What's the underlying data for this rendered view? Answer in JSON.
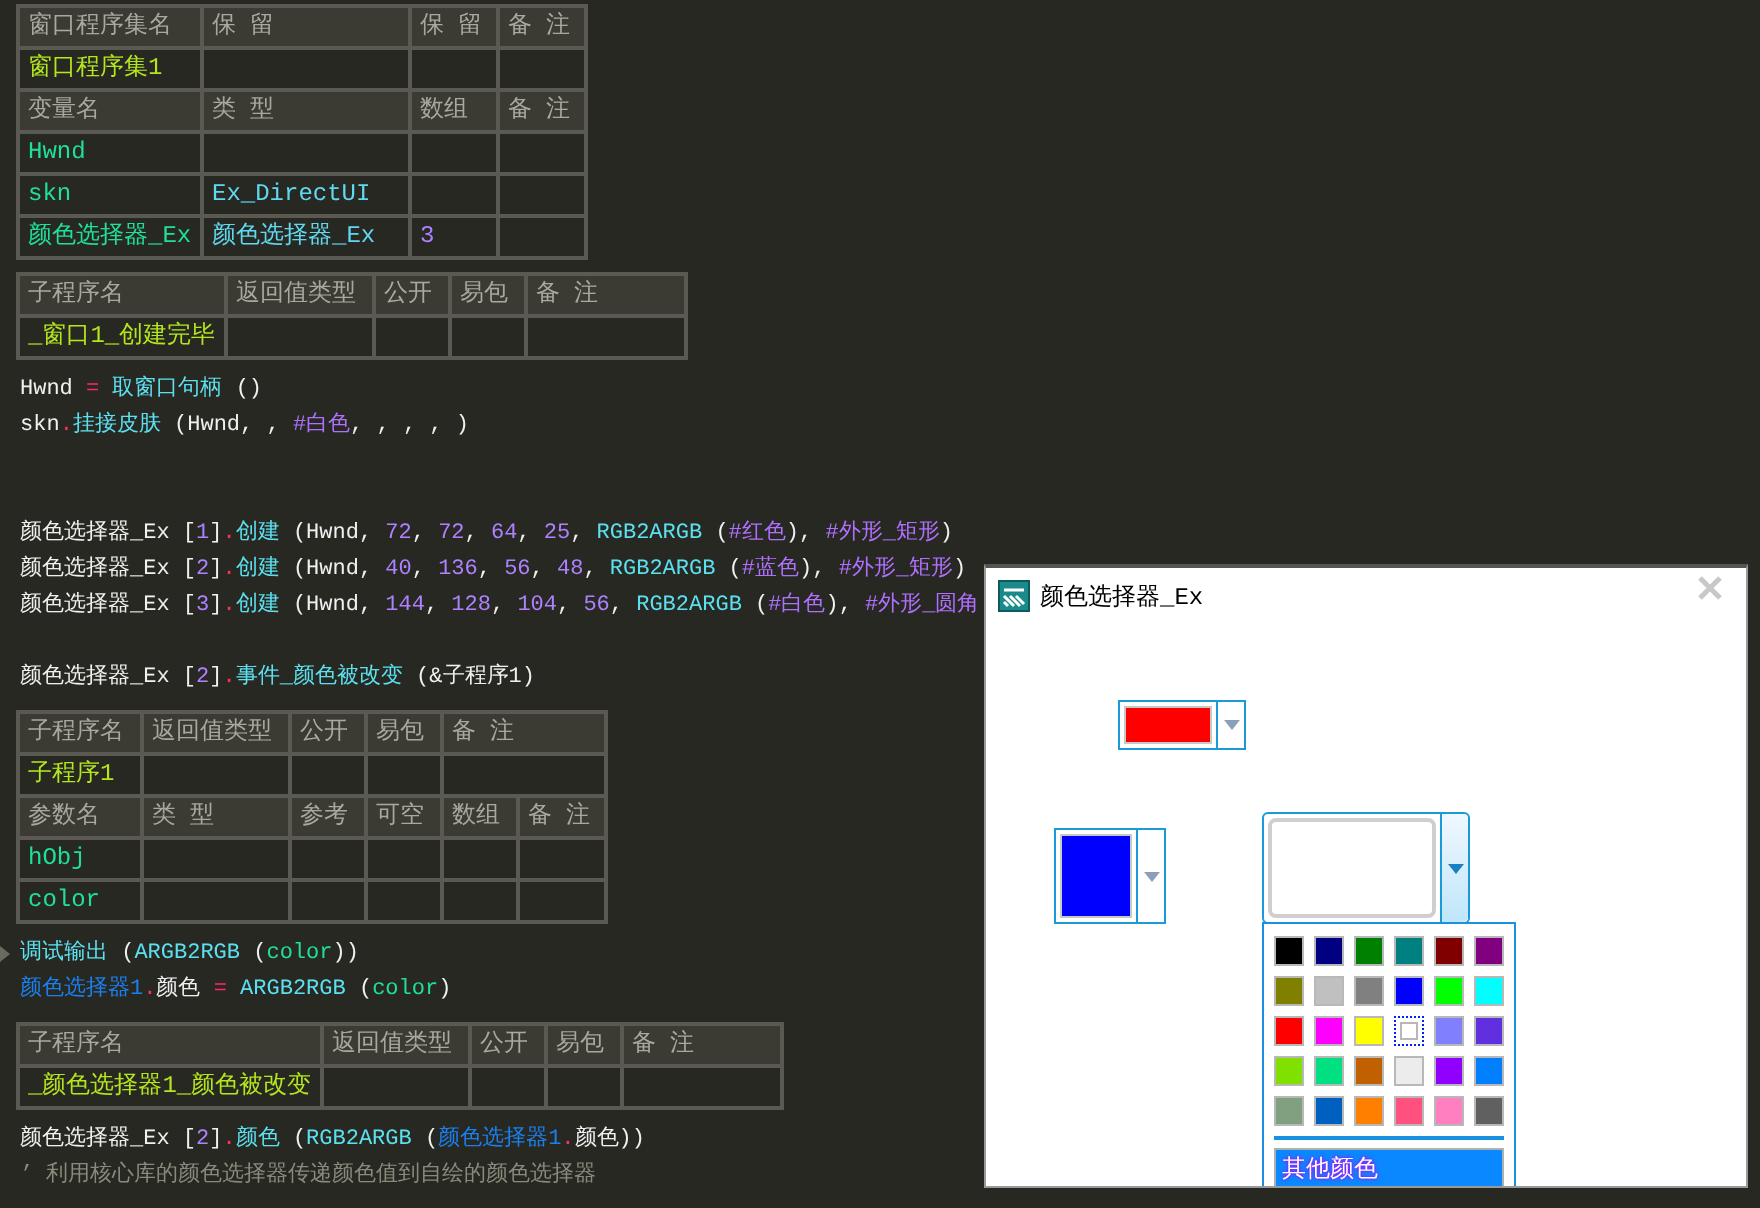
{
  "code": {
    "blocks": [
      {
        "kind": "table",
        "rows": [
          {
            "kind": "header",
            "cells": [
              {
                "text": "窗口程序集名",
                "kind": "head"
              },
              {
                "text": "保 留",
                "kind": "head"
              },
              {
                "text": "保 留",
                "kind": "head"
              },
              {
                "text": "备 注",
                "kind": "head"
              }
            ]
          },
          {
            "kind": "data",
            "cells": [
              {
                "text": "窗口程序集1",
                "kind": "name"
              }
            ]
          },
          {
            "kind": "header",
            "cells": [
              {
                "text": "变量名",
                "kind": "head"
              },
              {
                "text": "类 型",
                "kind": "head"
              },
              {
                "text": "数组",
                "kind": "head"
              },
              {
                "text": "备 注",
                "kind": "head"
              }
            ]
          },
          {
            "kind": "data",
            "cells": [
              {
                "text": "Hwnd",
                "kind": "var"
              }
            ]
          },
          {
            "kind": "data",
            "cells": [
              {
                "text": "skn",
                "kind": "var"
              },
              {
                "text": "Ex_DirectUI",
                "kind": "type"
              }
            ]
          },
          {
            "kind": "data",
            "cells": [
              {
                "text": "颜色选择器_Ex",
                "kind": "var"
              },
              {
                "text": "颜色选择器_Ex",
                "kind": "type"
              },
              {
                "text": "3",
                "kind": "num"
              }
            ]
          }
        ]
      },
      {
        "kind": "table",
        "rows": [
          {
            "kind": "header",
            "cells": [
              {
                "text": "子程序名",
                "kind": "head"
              },
              {
                "text": "返回值类型",
                "kind": "head"
              },
              {
                "text": "公开",
                "kind": "head"
              },
              {
                "text": "易包",
                "kind": "head"
              },
              {
                "text": "备 注",
                "kind": "head"
              }
            ]
          },
          {
            "kind": "data",
            "cells": [
              {
                "text": "_窗口1_创建完毕",
                "kind": "name"
              }
            ]
          }
        ]
      },
      {
        "kind": "line",
        "tokens": [
          {
            "text": "Hwnd ",
            "kind": "plain"
          },
          {
            "text": "=",
            "kind": "op"
          },
          {
            "text": " 取窗口句柄",
            "kind": "func"
          },
          {
            "text": " ()",
            "kind": "plain"
          }
        ]
      },
      {
        "kind": "line",
        "tokens": [
          {
            "text": "skn",
            "kind": "plain"
          },
          {
            "text": ".",
            "kind": "dot"
          },
          {
            "text": "挂接皮肤",
            "kind": "func"
          },
          {
            "text": " (Hwnd, , ",
            "kind": "plain"
          },
          {
            "text": "#白色",
            "kind": "const"
          },
          {
            "text": ", , , , )",
            "kind": "plain"
          }
        ]
      },
      {
        "kind": "blank"
      },
      {
        "kind": "blank"
      },
      {
        "kind": "line",
        "tokens": [
          {
            "text": "颜色选择器_Ex [",
            "kind": "plain"
          },
          {
            "text": "1",
            "kind": "num"
          },
          {
            "text": "]",
            "kind": "plain"
          },
          {
            "text": ".",
            "kind": "dot"
          },
          {
            "text": "创建",
            "kind": "func"
          },
          {
            "text": " (Hwnd, ",
            "kind": "plain"
          },
          {
            "text": "72",
            "kind": "num"
          },
          {
            "text": ", ",
            "kind": "plain"
          },
          {
            "text": "72",
            "kind": "num"
          },
          {
            "text": ", ",
            "kind": "plain"
          },
          {
            "text": "64",
            "kind": "num"
          },
          {
            "text": ", ",
            "kind": "plain"
          },
          {
            "text": "25",
            "kind": "num"
          },
          {
            "text": ", ",
            "kind": "plain"
          },
          {
            "text": "RGB2ARGB",
            "kind": "func"
          },
          {
            "text": " (",
            "kind": "plain"
          },
          {
            "text": "#红色",
            "kind": "const"
          },
          {
            "text": "), ",
            "kind": "plain"
          },
          {
            "text": "#外形_矩形",
            "kind": "const"
          },
          {
            "text": ")",
            "kind": "plain"
          }
        ]
      },
      {
        "kind": "line",
        "tokens": [
          {
            "text": "颜色选择器_Ex [",
            "kind": "plain"
          },
          {
            "text": "2",
            "kind": "num"
          },
          {
            "text": "]",
            "kind": "plain"
          },
          {
            "text": ".",
            "kind": "dot"
          },
          {
            "text": "创建",
            "kind": "func"
          },
          {
            "text": " (Hwnd, ",
            "kind": "plain"
          },
          {
            "text": "40",
            "kind": "num"
          },
          {
            "text": ", ",
            "kind": "plain"
          },
          {
            "text": "136",
            "kind": "num"
          },
          {
            "text": ", ",
            "kind": "plain"
          },
          {
            "text": "56",
            "kind": "num"
          },
          {
            "text": ", ",
            "kind": "plain"
          },
          {
            "text": "48",
            "kind": "num"
          },
          {
            "text": ", ",
            "kind": "plain"
          },
          {
            "text": "RGB2ARGB",
            "kind": "func"
          },
          {
            "text": " (",
            "kind": "plain"
          },
          {
            "text": "#蓝色",
            "kind": "const"
          },
          {
            "text": "), ",
            "kind": "plain"
          },
          {
            "text": "#外形_矩形",
            "kind": "const"
          },
          {
            "text": ")",
            "kind": "plain"
          }
        ]
      },
      {
        "kind": "line",
        "tokens": [
          {
            "text": "颜色选择器_Ex [",
            "kind": "plain"
          },
          {
            "text": "3",
            "kind": "num"
          },
          {
            "text": "]",
            "kind": "plain"
          },
          {
            "text": ".",
            "kind": "dot"
          },
          {
            "text": "创建",
            "kind": "func"
          },
          {
            "text": " (Hwnd, ",
            "kind": "plain"
          },
          {
            "text": "144",
            "kind": "num"
          },
          {
            "text": ", ",
            "kind": "plain"
          },
          {
            "text": "128",
            "kind": "num"
          },
          {
            "text": ", ",
            "kind": "plain"
          },
          {
            "text": "104",
            "kind": "num"
          },
          {
            "text": ", ",
            "kind": "plain"
          },
          {
            "text": "56",
            "kind": "num"
          },
          {
            "text": ", ",
            "kind": "plain"
          },
          {
            "text": "RGB2ARGB",
            "kind": "func"
          },
          {
            "text": " (",
            "kind": "plain"
          },
          {
            "text": "#白色",
            "kind": "const"
          },
          {
            "text": "), ",
            "kind": "plain"
          },
          {
            "text": "#外形_圆角",
            "kind": "const"
          }
        ]
      },
      {
        "kind": "blank"
      },
      {
        "kind": "line",
        "tokens": [
          {
            "text": "颜色选择器_Ex [",
            "kind": "plain"
          },
          {
            "text": "2",
            "kind": "num"
          },
          {
            "text": "]",
            "kind": "plain"
          },
          {
            "text": ".",
            "kind": "dot"
          },
          {
            "text": "事件_颜色被改变",
            "kind": "func"
          },
          {
            "text": " (&子程序1)",
            "kind": "plain"
          }
        ]
      },
      {
        "kind": "table",
        "rows": [
          {
            "kind": "header",
            "cells": [
              {
                "text": "子程序名",
                "kind": "head"
              },
              {
                "text": "返回值类型",
                "kind": "head"
              },
              {
                "text": "公开",
                "kind": "head"
              },
              {
                "text": "易包",
                "kind": "head"
              },
              {
                "text": "备 注",
                "kind": "head"
              }
            ]
          },
          {
            "kind": "data",
            "cells": [
              {
                "text": "子程序1",
                "kind": "name"
              }
            ]
          },
          {
            "kind": "header",
            "cells": [
              {
                "text": "参数名",
                "kind": "head"
              },
              {
                "text": "类 型",
                "kind": "head"
              },
              {
                "text": "参考",
                "kind": "head"
              },
              {
                "text": "可空",
                "kind": "head"
              },
              {
                "text": "数组",
                "kind": "head"
              },
              {
                "text": "备 注",
                "kind": "head"
              }
            ]
          },
          {
            "kind": "data",
            "cells": [
              {
                "text": "hObj",
                "kind": "var"
              }
            ]
          },
          {
            "kind": "data",
            "cells": [
              {
                "text": "color",
                "kind": "var"
              }
            ]
          }
        ]
      },
      {
        "kind": "line",
        "marker": true,
        "tokens": [
          {
            "text": "调试输出",
            "kind": "func"
          },
          {
            "text": " (",
            "kind": "plain"
          },
          {
            "text": "ARGB2RGB",
            "kind": "func"
          },
          {
            "text": " (",
            "kind": "plain"
          },
          {
            "text": "color",
            "kind": "var"
          },
          {
            "text": "))",
            "kind": "plain"
          }
        ]
      },
      {
        "kind": "line",
        "tokens": [
          {
            "text": "颜色选择器1",
            "kind": "obj"
          },
          {
            "text": ".",
            "kind": "dot"
          },
          {
            "text": "颜色 ",
            "kind": "plain"
          },
          {
            "text": "=",
            "kind": "op"
          },
          {
            "text": " ARGB2RGB",
            "kind": "func"
          },
          {
            "text": " (",
            "kind": "plain"
          },
          {
            "text": "color",
            "kind": "var"
          },
          {
            "text": ")",
            "kind": "plain"
          }
        ]
      },
      {
        "kind": "table",
        "rows": [
          {
            "kind": "header",
            "cells": [
              {
                "text": "子程序名",
                "kind": "head"
              },
              {
                "text": "返回值类型",
                "kind": "head"
              },
              {
                "text": "公开",
                "kind": "head"
              },
              {
                "text": "易包",
                "kind": "head"
              },
              {
                "text": "备 注",
                "kind": "head"
              }
            ]
          },
          {
            "kind": "data",
            "cells": [
              {
                "text": "_颜色选择器1_颜色被改变",
                "kind": "name"
              }
            ]
          }
        ]
      },
      {
        "kind": "line",
        "tokens": [
          {
            "text": "颜色选择器_Ex [",
            "kind": "plain"
          },
          {
            "text": "2",
            "kind": "num"
          },
          {
            "text": "]",
            "kind": "plain"
          },
          {
            "text": ".",
            "kind": "dot"
          },
          {
            "text": "颜色",
            "kind": "func"
          },
          {
            "text": " (",
            "kind": "plain"
          },
          {
            "text": "RGB2ARGB",
            "kind": "func"
          },
          {
            "text": " (",
            "kind": "plain"
          },
          {
            "text": "颜色选择器1",
            "kind": "obj"
          },
          {
            "text": ".",
            "kind": "dot"
          },
          {
            "text": "颜色",
            "kind": "plain"
          },
          {
            "text": "))",
            "kind": "plain"
          }
        ]
      },
      {
        "kind": "line",
        "tokens": [
          {
            "text": "’ 利用核心库的颜色选择器传递颜色值到自绘的颜色选择器",
            "kind": "comment"
          }
        ]
      }
    ]
  },
  "dialog": {
    "title": "颜色选择器_Ex",
    "pickers": [
      {
        "color": "#ff0000",
        "expanded": false
      },
      {
        "color": "#0000ff",
        "expanded": false
      },
      {
        "color": "#ffffff",
        "expanded": true
      }
    ],
    "palette": {
      "colors": [
        {
          "color": "#000000",
          "selected": false
        },
        {
          "color": "#000080",
          "selected": false
        },
        {
          "color": "#008000",
          "selected": false
        },
        {
          "color": "#008080",
          "selected": false
        },
        {
          "color": "#800000",
          "selected": false
        },
        {
          "color": "#800080",
          "selected": false
        },
        {
          "color": "#808000",
          "selected": false
        },
        {
          "color": "#c0c0c0",
          "selected": false
        },
        {
          "color": "#808080",
          "selected": false
        },
        {
          "color": "#0000ff",
          "selected": false
        },
        {
          "color": "#00ff00",
          "selected": false
        },
        {
          "color": "#00ffff",
          "selected": false
        },
        {
          "color": "#ff0000",
          "selected": false
        },
        {
          "color": "#ff00ff",
          "selected": false
        },
        {
          "color": "#ffff00",
          "selected": false
        },
        {
          "color": "#ffffff",
          "selected": true
        },
        {
          "color": "#8080ff",
          "selected": false
        },
        {
          "color": "#6030e0",
          "selected": false
        },
        {
          "color": "#80e000",
          "selected": false
        },
        {
          "color": "#00e080",
          "selected": false
        },
        {
          "color": "#c06000",
          "selected": false
        },
        {
          "color": "#ececec",
          "selected": false
        },
        {
          "color": "#9000ff",
          "selected": false
        },
        {
          "color": "#0080ff",
          "selected": false
        },
        {
          "color": "#80a080",
          "selected": false
        },
        {
          "color": "#0060c0",
          "selected": false
        },
        {
          "color": "#ff8000",
          "selected": false
        },
        {
          "color": "#ff5080",
          "selected": false
        },
        {
          "color": "#ff80c0",
          "selected": false
        },
        {
          "color": "#606060",
          "selected": false
        }
      ],
      "more_button": "其他颜色"
    }
  }
}
